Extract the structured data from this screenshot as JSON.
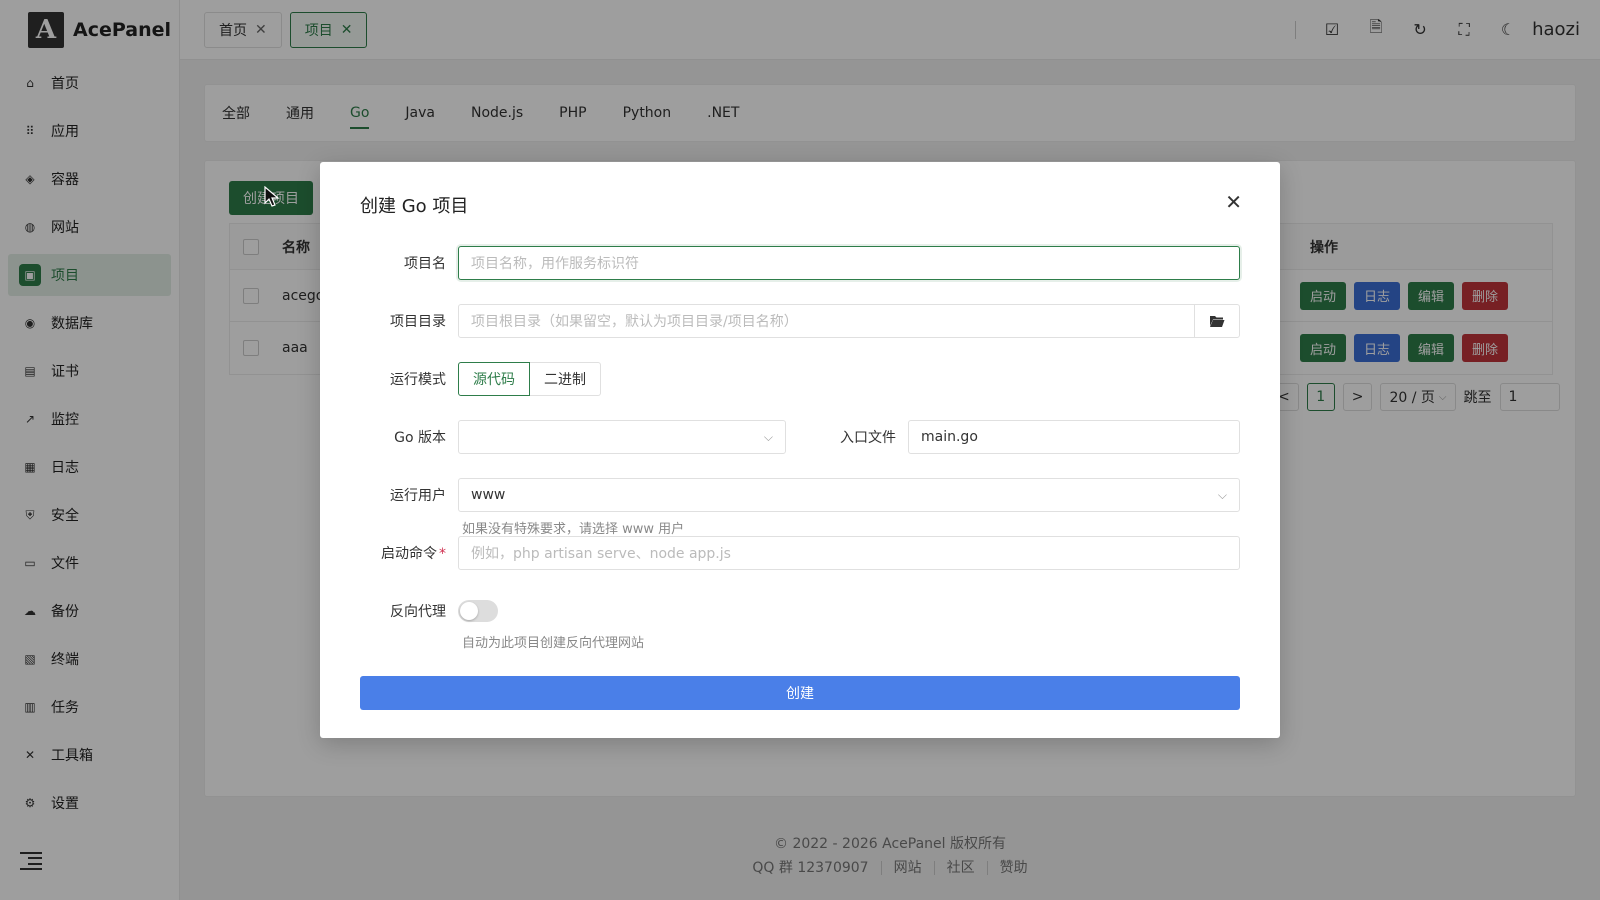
{
  "app": {
    "logo_letter": "A",
    "name": "AcePanel"
  },
  "sidebar": {
    "items": [
      {
        "label": "首页",
        "icon": "⌂"
      },
      {
        "label": "应用",
        "icon": "⠿"
      },
      {
        "label": "容器",
        "icon": "◈"
      },
      {
        "label": "网站",
        "icon": "◍"
      },
      {
        "label": "项目",
        "icon": "▣"
      },
      {
        "label": "数据库",
        "icon": "◉"
      },
      {
        "label": "证书",
        "icon": "▤"
      },
      {
        "label": "监控",
        "icon": "↗"
      },
      {
        "label": "日志",
        "icon": "▦"
      },
      {
        "label": "安全",
        "icon": "⛨"
      },
      {
        "label": "文件",
        "icon": "▭"
      },
      {
        "label": "备份",
        "icon": "☁"
      },
      {
        "label": "终端",
        "icon": "▧"
      },
      {
        "label": "任务",
        "icon": "▥"
      },
      {
        "label": "工具箱",
        "icon": "✕"
      },
      {
        "label": "设置",
        "icon": "⚙"
      }
    ],
    "active_index": 4
  },
  "header": {
    "tabs": [
      {
        "label": "首页",
        "active": false
      },
      {
        "label": "项目",
        "active": true
      }
    ],
    "icons": [
      "checkbox-icon",
      "document-icon",
      "refresh-icon",
      "fullscreen-icon",
      "moon-icon"
    ],
    "username": "haozi"
  },
  "filter_tabs": {
    "items": [
      "全部",
      "通用",
      "Go",
      "Java",
      "Node.js",
      "PHP",
      "Python",
      ".NET"
    ],
    "active": "Go"
  },
  "list": {
    "create_label": "创建项目",
    "columns": {
      "name": "名称",
      "ops": "操作"
    },
    "rows": [
      {
        "name": "acego"
      },
      {
        "name": "aaa"
      }
    ],
    "ops": {
      "start": "启动",
      "log": "日志",
      "edit": "编辑",
      "delete": "删除"
    },
    "pager": {
      "prev": "<",
      "page": "1",
      "next": ">",
      "page_size": "20 / 页",
      "jump_label": "跳至",
      "jump_value": "1"
    }
  },
  "footer": {
    "copyright": "© 2022 - 2026 AcePanel 版权所有",
    "qq": "QQ 群 12370907",
    "links": [
      "网站",
      "社区",
      "赞助"
    ]
  },
  "modal": {
    "title": "创建 Go 项目",
    "fields": {
      "name": {
        "label": "项目名",
        "placeholder": "项目名称，用作服务标识符"
      },
      "dir": {
        "label": "项目目录",
        "placeholder": "项目根目录（如果留空，默认为项目目录/项目名称）"
      },
      "mode": {
        "label": "运行模式",
        "options": [
          "源代码",
          "二进制"
        ],
        "selected": "源代码"
      },
      "go_version": {
        "label": "Go 版本",
        "value": ""
      },
      "entry": {
        "label": "入口文件",
        "value": "main.go"
      },
      "user": {
        "label": "运行用户",
        "value": "www",
        "hint": "如果没有特殊要求，请选择 www 用户"
      },
      "command": {
        "label": "启动命令",
        "required_mark": "*",
        "placeholder": "例如，php artisan serve、node app.js"
      },
      "proxy": {
        "label": "反向代理",
        "enabled": false,
        "hint": "自动为此项目创建反向代理网站"
      }
    },
    "submit_label": "创建"
  },
  "colors": {
    "primary_green": "#2e7d4a",
    "primary_blue": "#4a7fe8",
    "danger": "#c0343a"
  }
}
